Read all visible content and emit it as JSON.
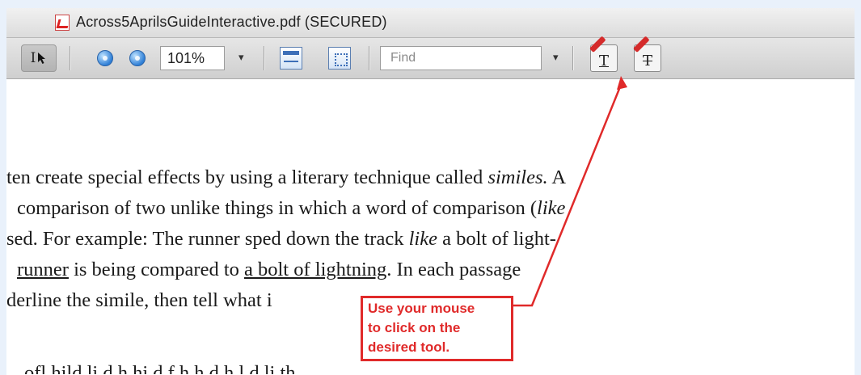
{
  "window": {
    "title": "Across5AprilsGuideInteractive.pdf (SECURED)",
    "icon": "pdf-document-icon"
  },
  "toolbar": {
    "select_tool_label": "I",
    "select_tool_icon": "text-select-cursor-icon",
    "zoom_out_icon": "zoom-out-icon",
    "zoom_in_icon": "zoom-in-icon",
    "zoom_value": "101%",
    "zoom_dropdown_arrow": "▾",
    "fit_width_icon": "fit-width-icon",
    "fit_page_icon": "fit-page-icon",
    "find_placeholder": "Find",
    "find_dropdown_arrow": "▾",
    "text_annotation_tool_label": "T",
    "text_annotation_tool_icon": "text-annotation-pencil-icon",
    "add_text_tool_label": "T",
    "add_text_tool_icon": "add-text-pencil-icon"
  },
  "document": {
    "lines": [
      [
        "ten create special effects by using a literary technique called ",
        "similes.",
        " A"
      ],
      [
        "comparison of two unlike things in which a word of comparison (",
        "like",
        ""
      ],
      [
        "sed. For example: The runner sped down the track ",
        "like",
        " a bolt of light-"
      ],
      [
        "",
        "runner",
        " is being compared to ",
        "a bolt of lightning",
        ". In each passage"
      ],
      [
        "derline the simile, then tell what i"
      ],
      [
        "ofl    hild    li   d    h     hi     d   f h  h    d    h  l   d   li     th"
      ]
    ]
  },
  "callout": {
    "line1": "Use your mouse",
    "line2": "to click on the",
    "line3": "desired tool.",
    "color": "#e02a2a"
  }
}
